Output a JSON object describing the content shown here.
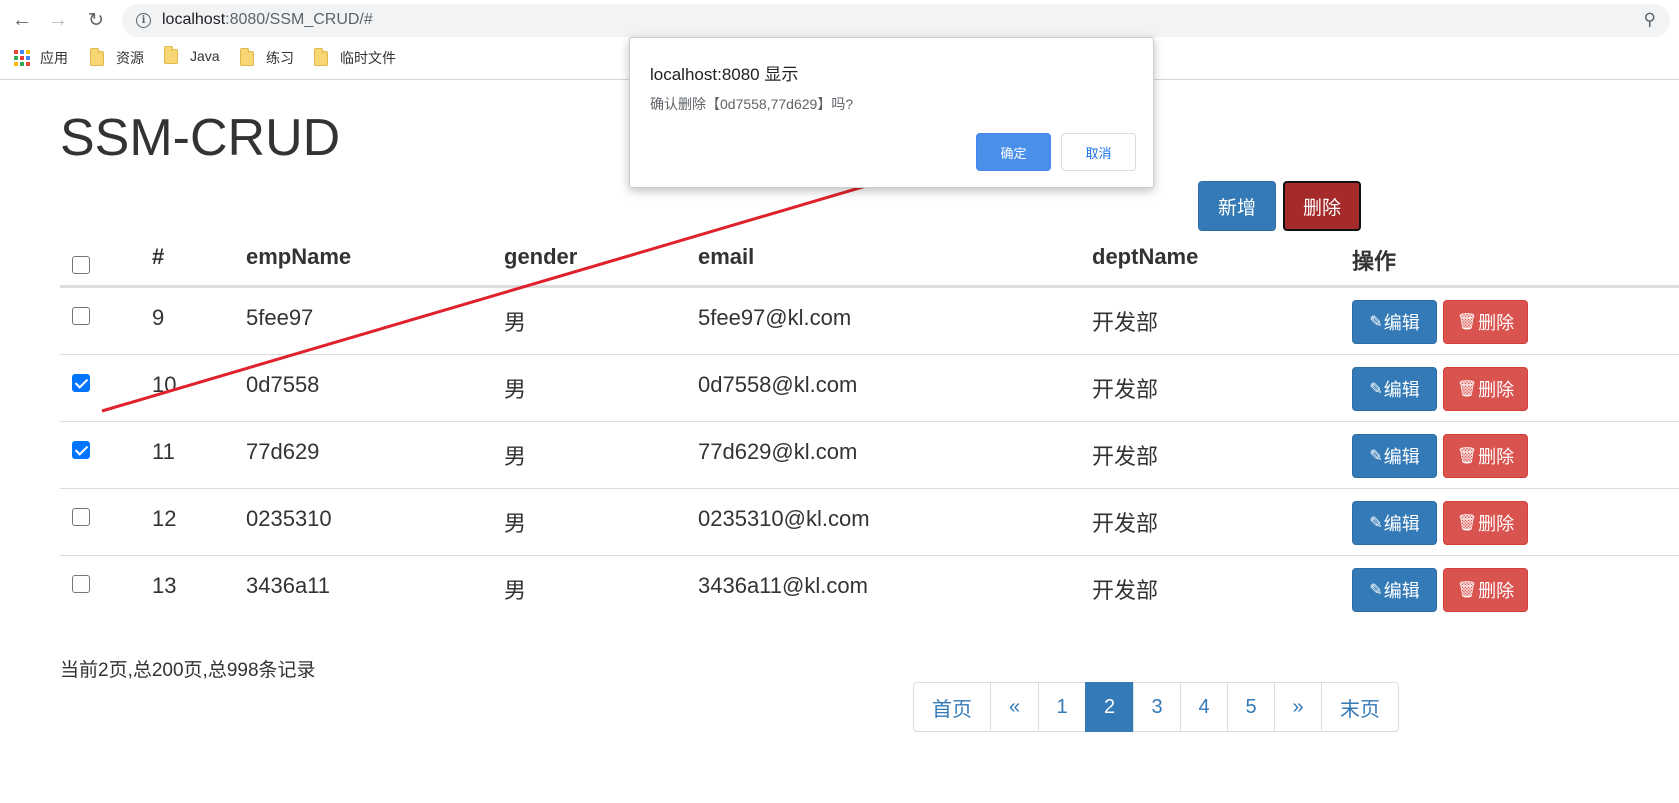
{
  "browser": {
    "url_host": "localhost",
    "url_path": ":8080/SSM_CRUD/#",
    "bookmarks": [
      "应用",
      "资源",
      "Java",
      "练习",
      "临时文件"
    ]
  },
  "page": {
    "title": "SSM-CRUD",
    "add_label": "新增",
    "delete_label": "删除"
  },
  "table": {
    "headers": [
      "#",
      "empName",
      "gender",
      "email",
      "deptName",
      "操作"
    ],
    "rows": [
      {
        "checked": false,
        "id": "9",
        "empName": "5fee97",
        "gender": "男",
        "email": "5fee97@kl.com",
        "deptName": "开发部"
      },
      {
        "checked": true,
        "id": "10",
        "empName": "0d7558",
        "gender": "男",
        "email": "0d7558@kl.com",
        "deptName": "开发部"
      },
      {
        "checked": true,
        "id": "11",
        "empName": "77d629",
        "gender": "男",
        "email": "77d629@kl.com",
        "deptName": "开发部"
      },
      {
        "checked": false,
        "id": "12",
        "empName": "0235310",
        "gender": "男",
        "email": "0235310@kl.com",
        "deptName": "开发部"
      },
      {
        "checked": false,
        "id": "13",
        "empName": "3436a11",
        "gender": "男",
        "email": "3436a11@kl.com",
        "deptName": "开发部"
      }
    ],
    "edit_label": "编辑",
    "row_delete_label": "删除"
  },
  "page_info": "当前2页,总200页,总998条记录",
  "pagination": {
    "items": [
      "首页",
      "«",
      "1",
      "2",
      "3",
      "4",
      "5",
      "»",
      "末页"
    ],
    "active": "2"
  },
  "dialog": {
    "title": "localhost:8080 显示",
    "message": "确认删除【0d7558,77d629】吗?",
    "ok_label": "确定",
    "cancel_label": "取消"
  },
  "colors": {
    "primary": "#337ab7",
    "danger": "#d9534f",
    "arrow": "#e0212b"
  }
}
